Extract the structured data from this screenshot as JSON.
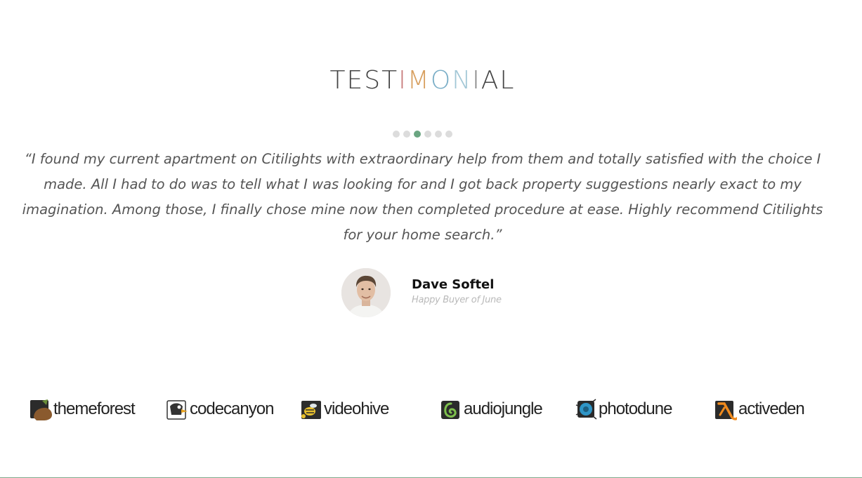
{
  "testimonial": {
    "title_chars": [
      {
        "c": "T",
        "color": "#444444"
      },
      {
        "c": "E",
        "color": "#444444"
      },
      {
        "c": "S",
        "color": "#444444"
      },
      {
        "c": "T",
        "color": "#444444"
      },
      {
        "c": "I",
        "color": "#c77a7a"
      },
      {
        "c": "M",
        "color": "#d8a060"
      },
      {
        "c": "O",
        "color": "#7aaec7"
      },
      {
        "c": "N",
        "color": "#a2c7d6"
      },
      {
        "c": "I",
        "color": "#888888"
      },
      {
        "c": "A",
        "color": "#444444"
      },
      {
        "c": "L",
        "color": "#444444"
      }
    ],
    "dots": [
      {
        "active": false
      },
      {
        "active": false
      },
      {
        "active": true
      },
      {
        "active": false
      },
      {
        "active": false
      },
      {
        "active": false
      }
    ],
    "quote": "“I found my current apartment on Citilights with extraordinary help from them and totally satisfied with the choice I made. All I had to do was to tell what I was looking for and I got back property suggestions nearly exact to my imagination. Among those, I finally chose mine now then completed procedure at ease. Highly recommend Citilights for your home search.”",
    "author_name": "Dave Softel",
    "author_role": "Happy Buyer of June"
  },
  "partners": [
    {
      "name": "themeforest",
      "icon": "themeforest-logo-icon"
    },
    {
      "name": "codecanyon",
      "icon": "codecanyon-logo-icon"
    },
    {
      "name": "videohive",
      "icon": "videohive-logo-icon"
    },
    {
      "name": "audiojungle",
      "icon": "audiojungle-logo-icon"
    },
    {
      "name": "photodune",
      "icon": "photodune-logo-icon"
    },
    {
      "name": "activeden",
      "icon": "activeden-logo-icon"
    }
  ],
  "colors": {
    "accent": "#6aa581",
    "dot_inactive": "#dcdcdc",
    "role_text": "#b9b9b9"
  }
}
